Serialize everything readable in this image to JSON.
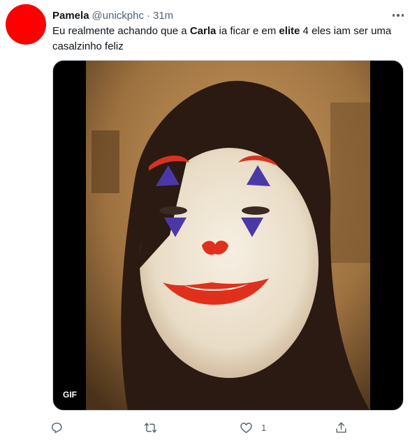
{
  "tweet": {
    "author_name": "Pamela",
    "author_handle": "@unickphc",
    "separator": "·",
    "timestamp": "31m",
    "text": {
      "part1": "Eu realmente achando que a ",
      "bold1": "Carla",
      "part2": " ia ficar e em ",
      "bold2": "elite",
      "part3": " 4 eles iam ser uma casalzinho feliz"
    },
    "media": {
      "badge": "GIF"
    },
    "actions": {
      "reply_icon": "reply-icon",
      "retweet_icon": "retweet-icon",
      "like_icon": "heart-icon",
      "like_count": "1",
      "share_icon": "share-icon"
    }
  },
  "colors": {
    "avatar": "#ff0000",
    "secondary_text": "#536471",
    "primary_text": "#0f1419"
  }
}
